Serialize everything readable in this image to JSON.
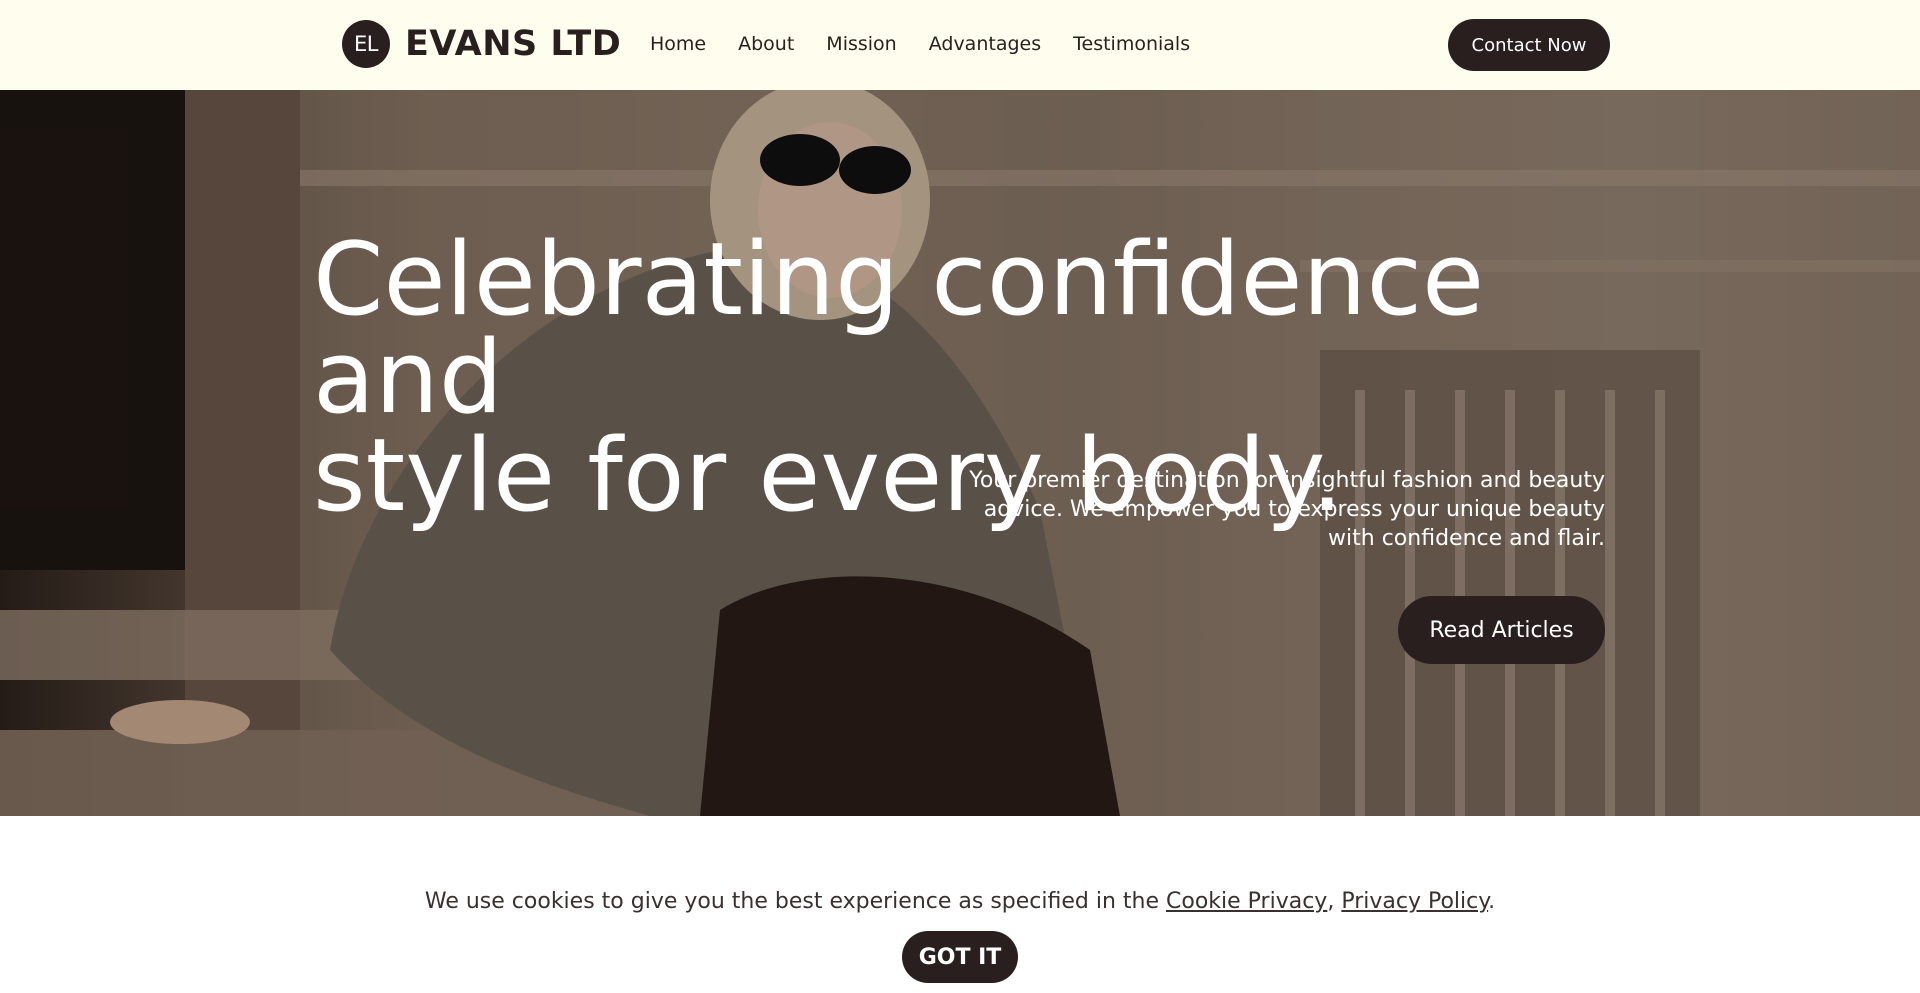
{
  "header": {
    "logo_initials": "EL",
    "brand": "EVANS LTD",
    "nav": [
      "Home",
      "About",
      "Mission",
      "Advantages",
      "Testimonials"
    ],
    "contact_label": "Contact Now"
  },
  "hero": {
    "title_line1": "Celebrating confidence and",
    "title_line2": "style for every body.",
    "subtitle": "Your premier destination for insightful fashion and beauty advice. We empower you to express your unique beauty with confidence and flair.",
    "cta_label": "Read Articles"
  },
  "cookie": {
    "text_before": "We use cookies to give you the best experience as specified in the ",
    "link1": "Cookie Privacy",
    "separator": ", ",
    "link2": "Privacy Policy",
    "text_after": ".",
    "button_label": "GOT IT"
  },
  "colors": {
    "header_bg": "#fefdee",
    "dark": "#2a1f1f",
    "white": "#ffffff"
  }
}
